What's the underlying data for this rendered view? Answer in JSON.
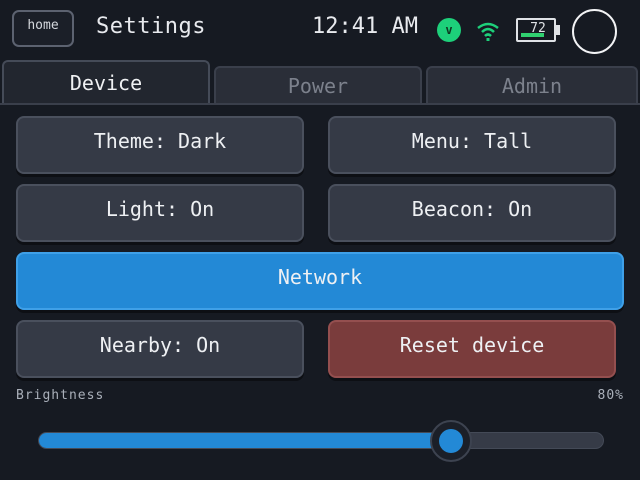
{
  "header": {
    "home_label": "home",
    "title": "Settings",
    "time": "12:41 AM",
    "badge_letter": "v",
    "battery_level": "72",
    "battery_fill_fraction": 0.72
  },
  "tabs": [
    {
      "label": "Device",
      "active": true
    },
    {
      "label": "Power",
      "active": false
    },
    {
      "label": "Admin",
      "active": false
    }
  ],
  "buttons": {
    "theme": "Theme: Dark",
    "menu": "Menu: Tall",
    "light": "Light: On",
    "beacon": "Beacon: On",
    "network": "Network",
    "nearby": "Nearby: On",
    "reset": "Reset device"
  },
  "brightness": {
    "label": "Brightness",
    "value_text": "80%",
    "value": 0.73
  },
  "colors": {
    "accent": "#2389d6",
    "danger": "#7a3c3c",
    "status_green": "#1dd07a"
  }
}
